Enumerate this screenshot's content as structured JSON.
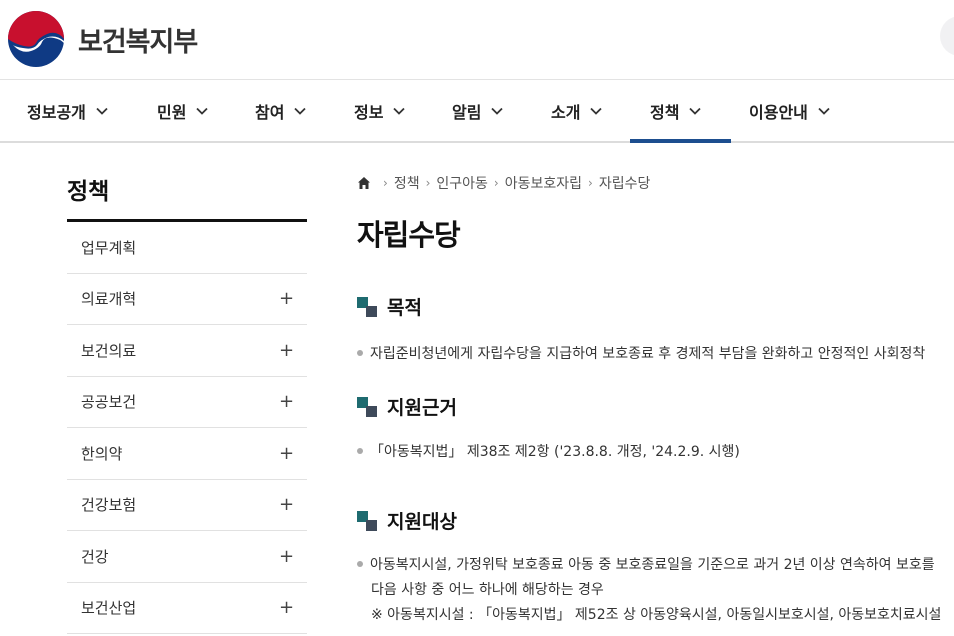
{
  "header": {
    "logo_text": "보건복지부",
    "colors": {
      "emblem_red": "#c8102e",
      "emblem_blue": "#0f3a84",
      "active_tab": "#1d4e8f"
    }
  },
  "gnb": {
    "items": [
      {
        "label": "정보공개"
      },
      {
        "label": "민원"
      },
      {
        "label": "참여"
      },
      {
        "label": "정보"
      },
      {
        "label": "알림"
      },
      {
        "label": "소개"
      },
      {
        "label": "정책",
        "active": true
      },
      {
        "label": "이용안내"
      }
    ],
    "chevron_icon": "chevron-down-icon"
  },
  "sidebar": {
    "title": "정책",
    "items": [
      {
        "label": "업무계획",
        "expandable": false
      },
      {
        "label": "의료개혁",
        "expandable": true
      },
      {
        "label": "보건의료",
        "expandable": true
      },
      {
        "label": "공공보건",
        "expandable": true
      },
      {
        "label": "한의약",
        "expandable": true
      },
      {
        "label": "건강보험",
        "expandable": true
      },
      {
        "label": "건강",
        "expandable": true
      },
      {
        "label": "보건산업",
        "expandable": true
      }
    ],
    "expand_symbol": "+"
  },
  "breadcrumb": {
    "items": [
      "정책",
      "인구아동",
      "아동보호자립",
      "자립수당"
    ],
    "separator": "›"
  },
  "page": {
    "title": "자립수당",
    "sections": [
      {
        "heading": "목적",
        "lines": [
          "자립준비청년에게 자립수당을 지급하여 보호종료 후 경제적 부담을 완화하고 안정적인 사회정착"
        ]
      },
      {
        "heading": "지원근거",
        "lines": [
          "「아동복지법」 제38조 제2항 ('23.8.8. 개정, '24.2.9. 시행)"
        ]
      },
      {
        "heading": "지원대상",
        "lines": [
          "아동복지시설, 가정위탁 보호종료 아동 중 보호종료일을 기준으로 과거 2년 이상 연속하여 보호를",
          "다음 사항 중 어느 하나에 해당하는 경우",
          "※ 아동복지시설 : 「아동복지법」 제52조 상 아동양육시설, 아동일시보호시설, 아동보호치료시설"
        ]
      }
    ]
  }
}
